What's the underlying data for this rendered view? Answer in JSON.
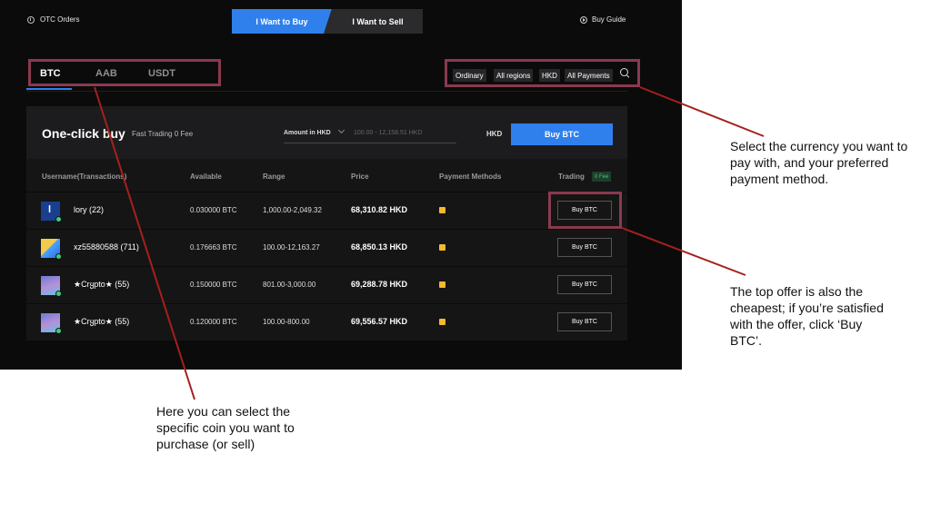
{
  "header": {
    "title": "OTC Orders",
    "buy_tab": "I Want to Buy",
    "sell_tab": "I Want to Sell",
    "guide": "Buy Guide"
  },
  "coins": {
    "btc": "BTC",
    "aab": "AAB",
    "usdt": "USDT"
  },
  "filters": {
    "type": "Ordinary",
    "region": "All regions",
    "currency": "HKD",
    "payments": "All Payments"
  },
  "oneclick": {
    "title": "One-click buy",
    "subtitle": "Fast Trading 0 Fee",
    "amount_label": "Amount in HKD",
    "amount_placeholder": "100.00 - 12,158.51 HKD",
    "currency": "HKD",
    "buy_label": "Buy BTC"
  },
  "table": {
    "headers": {
      "user": "Username(Transactions)",
      "available": "Available",
      "range": "Range",
      "price": "Price",
      "payment": "Payment Methods",
      "trading": "Trading",
      "fee": "0 Fee"
    },
    "rows": [
      {
        "user": "lory  (22)",
        "avatar": "l",
        "available": "0.030000 BTC",
        "range": "1,000.00-2,049.32",
        "price": "68,310.82 HKD",
        "action": "Buy BTC"
      },
      {
        "user": "xz55880588  (711)",
        "available": "0.176663 BTC",
        "range": "100.00-12,163.27",
        "price": "68,850.13 HKD",
        "action": "Buy BTC"
      },
      {
        "user": "★Crყpto★  (55)",
        "available": "0.150000 BTC",
        "range": "801.00-3,000.00",
        "price": "69,288.78 HKD",
        "action": "Buy BTC"
      },
      {
        "user": "★Crყpto★  (55)",
        "available": "0.120000 BTC",
        "range": "100.00-800.00",
        "price": "69,556.57 HKD",
        "action": "Buy BTC"
      }
    ]
  },
  "annotations": {
    "currency_note": "Select the currency you want to pay with, and your preferred payment method.",
    "offer_note": "The top offer is also the cheapest; if you’re satisfied with the offer, click ‘Buy BTC’.",
    "coin_note": "Here you can select the specific coin you want to purchase (or sell)"
  },
  "colors": {
    "accent": "#2f80ed",
    "highlight": "#8a3a4e",
    "annotation_line": "#a6201c"
  }
}
